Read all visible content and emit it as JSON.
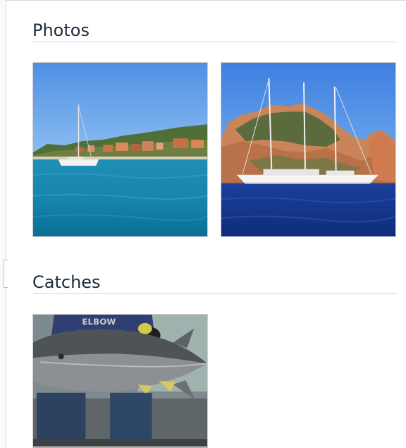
{
  "sections": {
    "photos": {
      "title": "Photos"
    },
    "catches": {
      "title": "Catches"
    }
  },
  "colors": {
    "heading": "#1d2b3a",
    "divider": "#c9d4dc"
  },
  "photos": [
    {
      "icon": "photo-thumbnail-icon"
    },
    {
      "icon": "photo-thumbnail-icon"
    }
  ],
  "catches": [
    {
      "icon": "photo-thumbnail-icon",
      "logo_text": "ELBOW"
    }
  ]
}
